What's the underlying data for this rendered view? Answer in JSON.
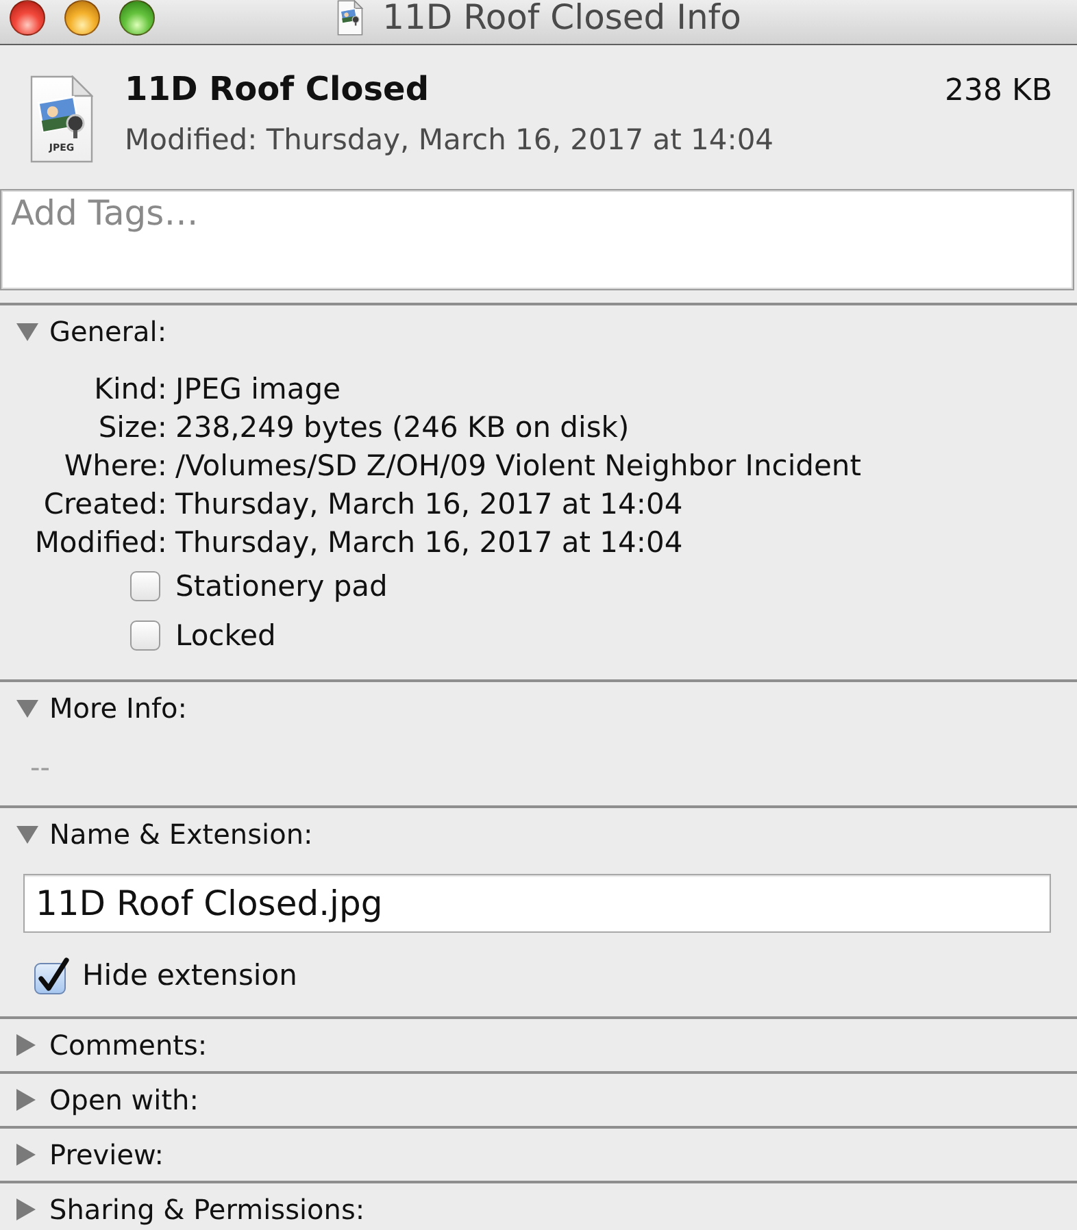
{
  "window": {
    "title": "11D Roof Closed Info"
  },
  "header": {
    "icon_label": "JPEG",
    "name": "11D Roof Closed",
    "size": "238 KB",
    "modified": "Modified: Thursday, March 16, 2017 at 14:04"
  },
  "tags": {
    "placeholder": "Add Tags…"
  },
  "sections": [
    {
      "kind": "general",
      "title": "General:",
      "expanded": true,
      "rows": [
        {
          "label": "Kind:",
          "value": "JPEG image"
        },
        {
          "label": "Size:",
          "value": "238,249 bytes (246 KB on disk)"
        },
        {
          "label": "Where:",
          "value": "/Volumes/SD Z/OH/09 Violent Neighbor Incident"
        },
        {
          "label": "Created:",
          "value": "Thursday, March 16, 2017 at 14:04"
        },
        {
          "label": "Modified:",
          "value": "Thursday, March 16, 2017 at 14:04"
        }
      ],
      "checkboxes": [
        {
          "label": "Stationery pad",
          "checked": false
        },
        {
          "label": "Locked",
          "checked": false
        }
      ]
    },
    {
      "kind": "more_info",
      "title": "More Info:",
      "expanded": true,
      "text": "--"
    },
    {
      "kind": "name_extension",
      "title": "Name & Extension:",
      "expanded": true,
      "name_field": {
        "value": "11D Roof Closed.jpg"
      },
      "checkboxes": [
        {
          "label": "Hide extension",
          "checked": true
        }
      ]
    },
    {
      "kind": "comments",
      "title": "Comments:",
      "expanded": false
    },
    {
      "kind": "open_with",
      "title": "Open with:",
      "expanded": false
    },
    {
      "kind": "preview",
      "title": "Preview:",
      "expanded": false
    },
    {
      "kind": "sharing_permissions",
      "title": "Sharing & Permissions:",
      "expanded": false
    }
  ]
}
